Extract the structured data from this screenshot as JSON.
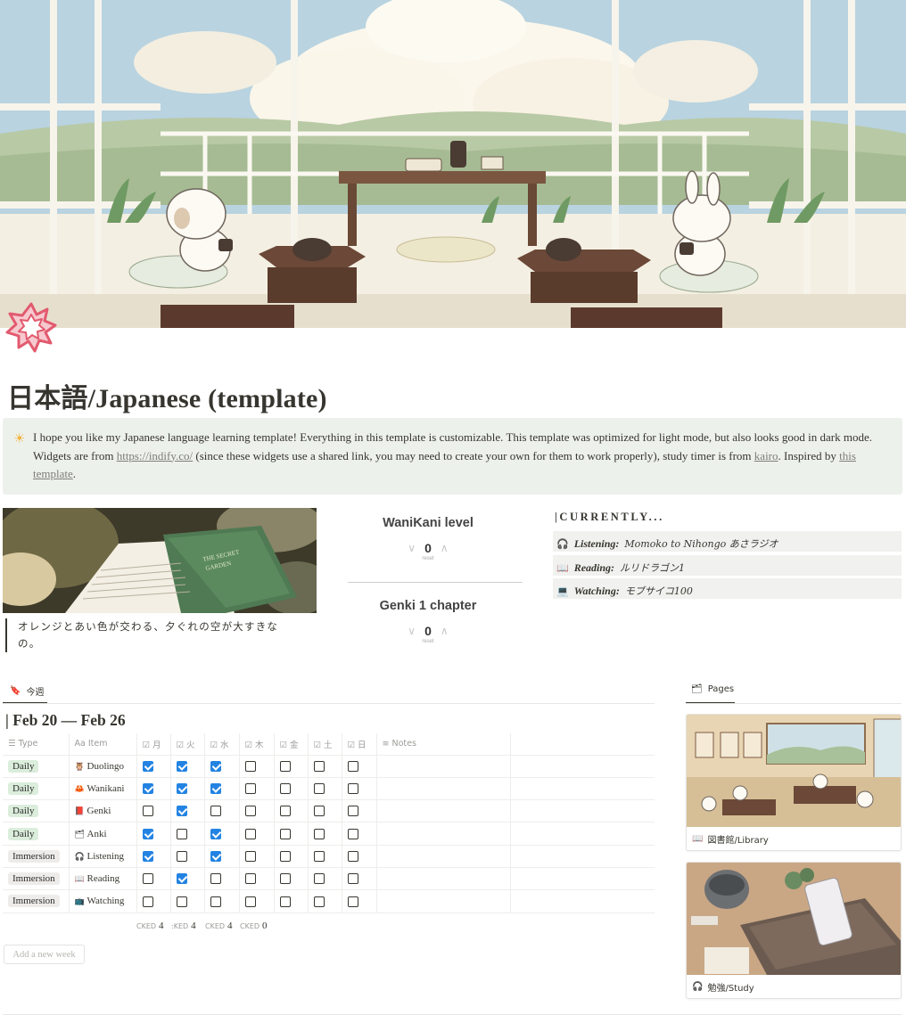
{
  "page": {
    "title": "日本語/Japanese (template)"
  },
  "callout": {
    "icon": "sun-icon",
    "text_1": "I hope you like my Japanese language learning template! Everything in this template is customizable. This template was optimized for light mode, but also looks good in dark mode. Widgets are from ",
    "link_1": "https://indify.co/",
    "text_2": " (since these widgets use a shared link, you may need to create your own for them to work properly), study timer is from ",
    "link_2": "kairo",
    "text_3": ". Inspired by ",
    "link_3": "this template",
    "text_4": "."
  },
  "quote": "オレンジとあい色が交わる、夕ぐれの空が大すきなの。",
  "counters": [
    {
      "title": "WaniKani level",
      "value": "0",
      "reset": "reset"
    },
    {
      "title": "Genki 1 chapter",
      "value": "0",
      "reset": "reset"
    }
  ],
  "currently": {
    "heading": "|CURRENTLY...",
    "items": [
      {
        "icon": "headphones-icon",
        "label": "Listening:",
        "value": "Momoko to Nihongo あさラジオ"
      },
      {
        "icon": "book-icon",
        "label": "Reading:",
        "value": "ルリドラゴン1"
      },
      {
        "icon": "laptop-icon",
        "label": "Watching:",
        "value": "モブサイコ100"
      }
    ]
  },
  "tabs": {
    "week": "今週",
    "pages": "Pages"
  },
  "week": {
    "title": "| Feb 20 — Feb 26",
    "columns": {
      "type": "Type",
      "item": "Item",
      "days": [
        "月",
        "火",
        "水",
        "木",
        "金",
        "土",
        "日"
      ],
      "notes": "Notes"
    },
    "rows": [
      {
        "type": "Daily",
        "icon": "owl-icon",
        "item": "Duolingo",
        "checks": [
          true,
          true,
          true,
          false,
          false,
          false,
          false
        ]
      },
      {
        "type": "Daily",
        "icon": "crab-icon",
        "item": "Wanikani",
        "checks": [
          true,
          true,
          true,
          false,
          false,
          false,
          false
        ]
      },
      {
        "type": "Daily",
        "icon": "textbook-icon",
        "item": "Genki",
        "checks": [
          false,
          true,
          false,
          false,
          false,
          false,
          false
        ]
      },
      {
        "type": "Daily",
        "icon": "flashcard-icon",
        "item": "Anki",
        "checks": [
          true,
          false,
          true,
          false,
          false,
          false,
          false
        ]
      },
      {
        "type": "Immersion",
        "icon": "headphones-icon",
        "item": "Listening",
        "checks": [
          true,
          false,
          true,
          false,
          false,
          false,
          false
        ]
      },
      {
        "type": "Immersion",
        "icon": "open-book-icon",
        "item": "Reading",
        "checks": [
          false,
          true,
          false,
          false,
          false,
          false,
          false
        ]
      },
      {
        "type": "Immersion",
        "icon": "tv-icon",
        "item": "Watching",
        "checks": [
          false,
          false,
          false,
          false,
          false,
          false,
          false
        ]
      }
    ],
    "counts": [
      {
        "label": "CKED",
        "value": "4"
      },
      {
        "label": ":KED",
        "value": "4"
      },
      {
        "label": "CKED",
        "value": "4"
      },
      {
        "label": "CKED",
        "value": "0"
      }
    ],
    "add_button": "Add a new week"
  },
  "pages": [
    {
      "icon": "book-icon",
      "label": "図書館/Library"
    },
    {
      "icon": "headphones-icon",
      "label": "勉強/Study"
    }
  ],
  "colors": {
    "accent_blue": "#2383e2",
    "daily_tag": "#dbeddb",
    "immersion_tag": "#eeecea",
    "callout_bg": "#edf1ec",
    "page_icon": "#e25a6e"
  }
}
